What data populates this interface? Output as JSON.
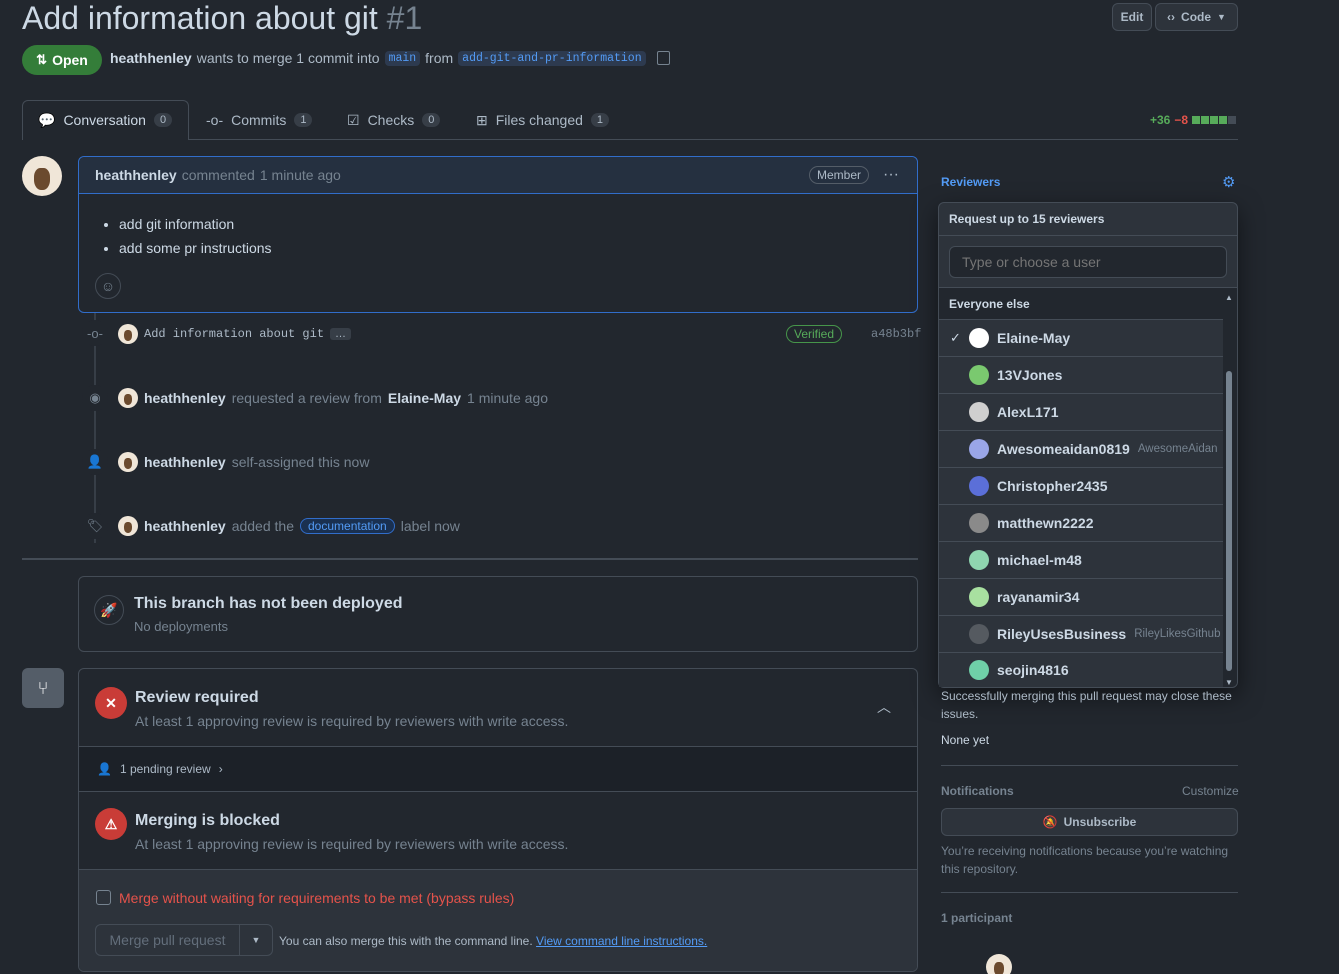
{
  "header": {
    "title": "Add information about git",
    "number": "#1",
    "edit_label": "Edit",
    "code_label": "Code",
    "status": "Open",
    "author": "heathhenley",
    "merge_text": "wants to merge 1 commit into",
    "base_branch": "main",
    "from_text": "from",
    "head_branch": "add-git-and-pr-information"
  },
  "tabs": [
    {
      "label": "Conversation",
      "count": "0"
    },
    {
      "label": "Commits",
      "count": "1"
    },
    {
      "label": "Checks",
      "count": "0"
    },
    {
      "label": "Files changed",
      "count": "1"
    }
  ],
  "diffstat": {
    "added": "+36",
    "removed": "−8"
  },
  "comment": {
    "author": "heathhenley",
    "action": "commented",
    "time": "1 minute ago",
    "badge": "Member",
    "bullets": [
      "add git information",
      "add some pr instructions"
    ]
  },
  "timeline": {
    "commit_message": "Add information about git",
    "commit_ellipsis": "…",
    "verified": "Verified",
    "sha": "a48b3bf",
    "review_request": {
      "actor": "heathhenley",
      "text": "requested a review from",
      "target": "Elaine-May",
      "time": "1 minute ago"
    },
    "assigned": {
      "actor": "heathhenley",
      "text": "self-assigned this now"
    },
    "label_event": {
      "actor": "heathhenley",
      "text": "added the",
      "label": "documentation",
      "after": "label now"
    }
  },
  "deploy": {
    "title": "This branch has not been deployed",
    "sub": "No deployments"
  },
  "merge_box": {
    "review_title": "Review required",
    "review_sub": "At least 1 approving review is required by reviewers with write access.",
    "pending": "1 pending review",
    "blocked_title": "Merging is blocked",
    "blocked_sub": "At least 1 approving review is required by reviewers with write access.",
    "bypass": "Merge without waiting for requirements to be met (bypass rules)",
    "merge_button": "Merge pull request",
    "cli_text": "You can also merge this with the command line.",
    "cli_link": "View command line instructions."
  },
  "sidebar": {
    "reviewers_label": "Reviewers",
    "dropdown_title": "Request up to 15 reviewers",
    "search_placeholder": "Type or choose a user",
    "group_label": "Everyone else",
    "users": [
      {
        "name": "Elaine-May",
        "sub": "",
        "color": "#ffffff",
        "checked": "✓"
      },
      {
        "name": "13VJones",
        "sub": "",
        "color": "#7ac96f",
        "checked": ""
      },
      {
        "name": "AlexL171",
        "sub": "",
        "color": "#cfcfcf",
        "checked": ""
      },
      {
        "name": "Awesomeaidan0819",
        "sub": "AwesomeAidan",
        "color": "#9aa6e8",
        "checked": ""
      },
      {
        "name": "Christopher2435",
        "sub": "",
        "color": "#5b6fd8",
        "checked": ""
      },
      {
        "name": "matthewn2222",
        "sub": "",
        "color": "#8a8a8a",
        "checked": ""
      },
      {
        "name": "michael-m48",
        "sub": "",
        "color": "#8fd6b0",
        "checked": ""
      },
      {
        "name": "rayanamir34",
        "sub": "",
        "color": "#a8e0a0",
        "checked": ""
      },
      {
        "name": "RileyUsesBusiness",
        "sub": "RileyLikesGithub",
        "color": "#555a60",
        "checked": ""
      },
      {
        "name": "seojin4816",
        "sub": "",
        "color": "#6fd0a8",
        "checked": ""
      }
    ],
    "dev_text": "Successfully merging this pull request may close these issues.",
    "none_yet": "None yet",
    "notifications_label": "Notifications",
    "customize": "Customize",
    "unsubscribe": "Unsubscribe",
    "notif_text": "You’re receiving notifications because you’re watching this repository.",
    "participants": "1 participant"
  }
}
